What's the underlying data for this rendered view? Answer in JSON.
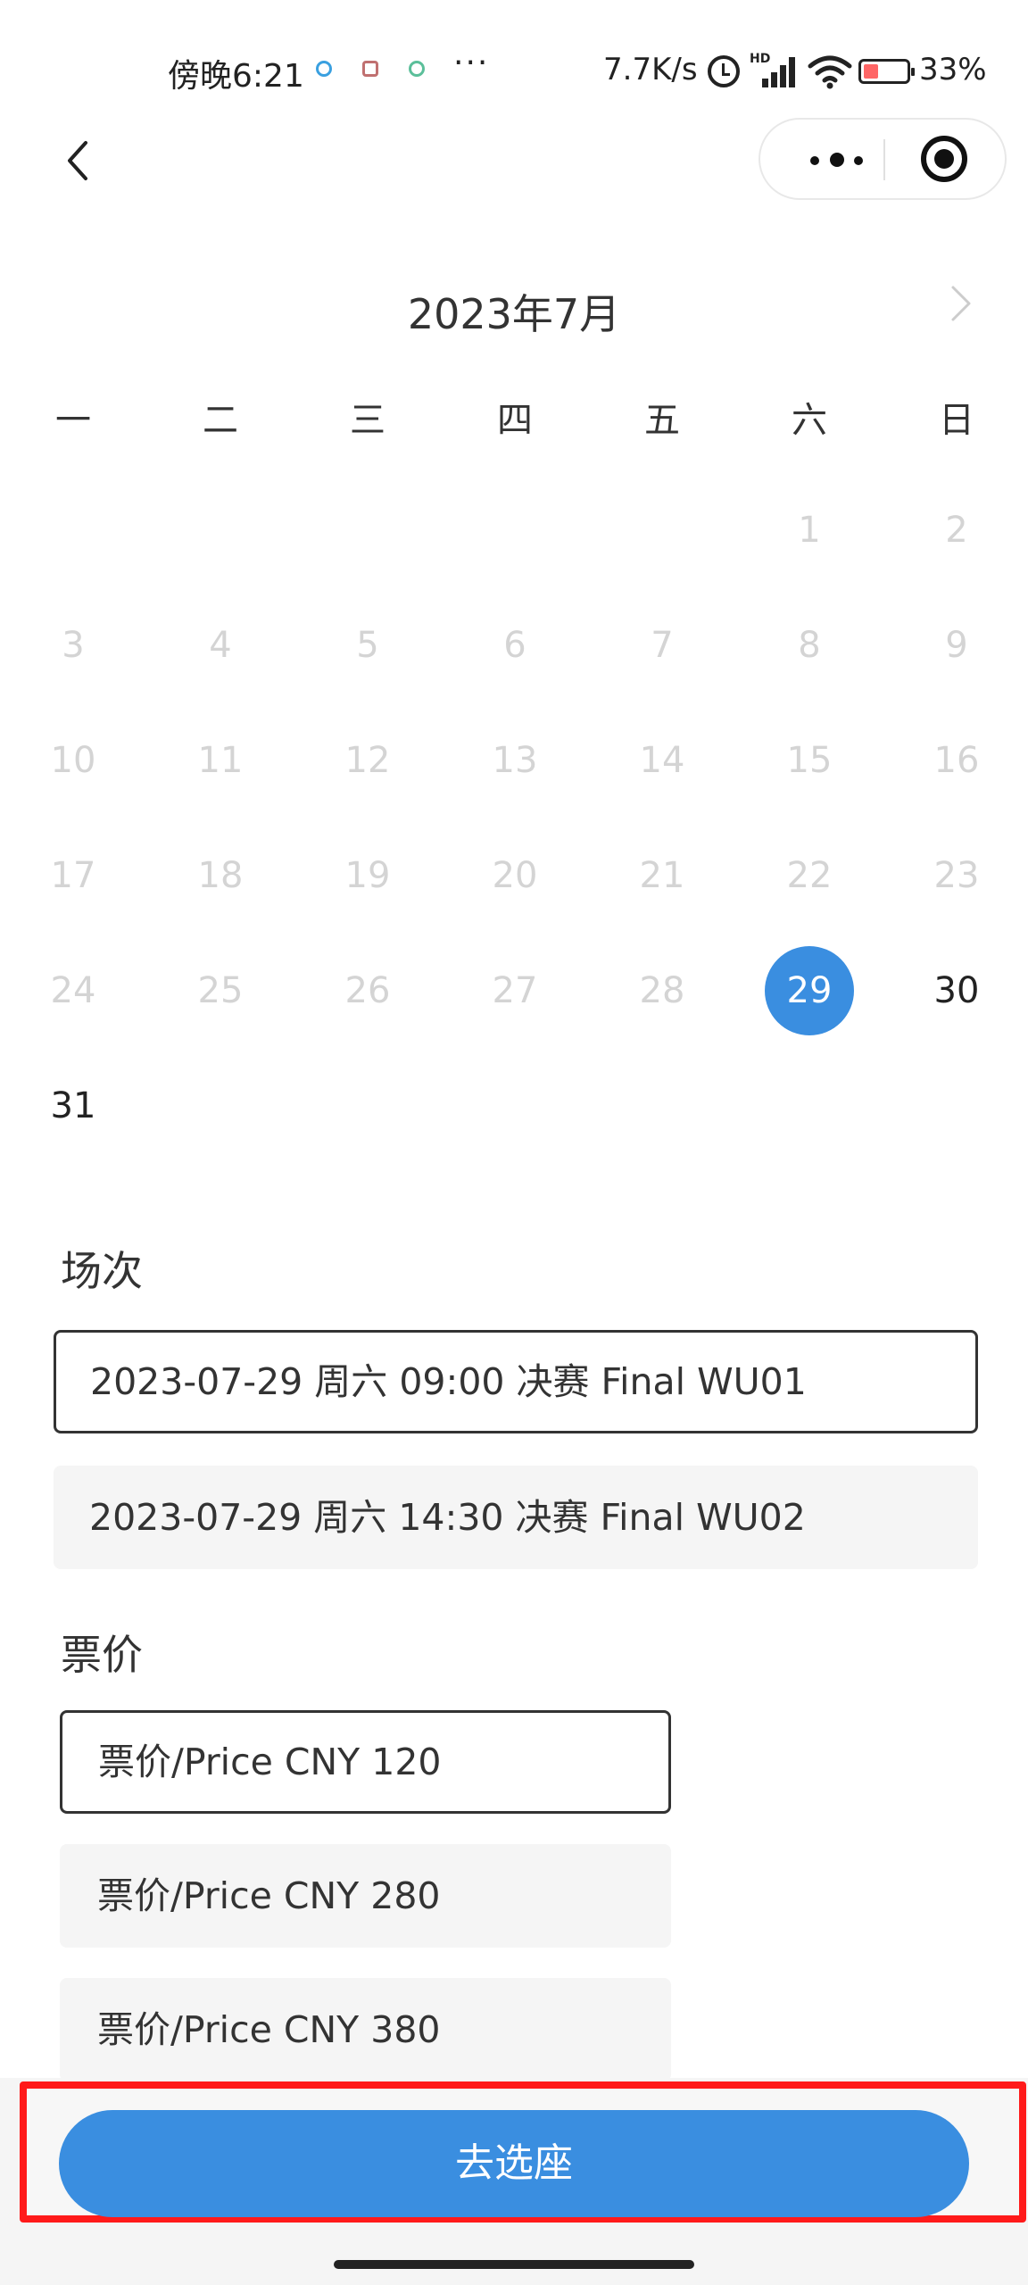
{
  "status_bar": {
    "time": "傍晚6:21",
    "more": "···",
    "network_speed": "7.7K/s",
    "hd_badge": "HD",
    "battery": "33%"
  },
  "calendar": {
    "month_title": "2023年7月",
    "weekdays": [
      "一",
      "二",
      "三",
      "四",
      "五",
      "六",
      "日"
    ],
    "days": [
      "1",
      "2",
      "3",
      "4",
      "5",
      "6",
      "7",
      "8",
      "9",
      "10",
      "11",
      "12",
      "13",
      "14",
      "15",
      "16",
      "17",
      "18",
      "19",
      "20",
      "21",
      "22",
      "23",
      "24",
      "25",
      "26",
      "27",
      "28",
      "29",
      "30",
      "31"
    ],
    "selected_day": "29",
    "available_days": [
      "29",
      "30",
      "31"
    ],
    "selected_color": "#3a8ee0"
  },
  "sessions": {
    "label": "场次",
    "items": [
      {
        "text": "2023-07-29 周六 09:00 决赛 Final WU01",
        "selected": true
      },
      {
        "text": "2023-07-29 周六 14:30 决赛 Final WU02",
        "selected": false
      }
    ]
  },
  "prices": {
    "label": "票价",
    "items": [
      {
        "text": "票价/Price CNY 120",
        "selected": true
      },
      {
        "text": "票价/Price CNY 280",
        "selected": false
      },
      {
        "text": "票价/Price CNY 380",
        "selected": false
      }
    ]
  },
  "cta": {
    "label": "去选座",
    "color": "#3a8ee0",
    "highlight_color": "#ff1a1a"
  }
}
